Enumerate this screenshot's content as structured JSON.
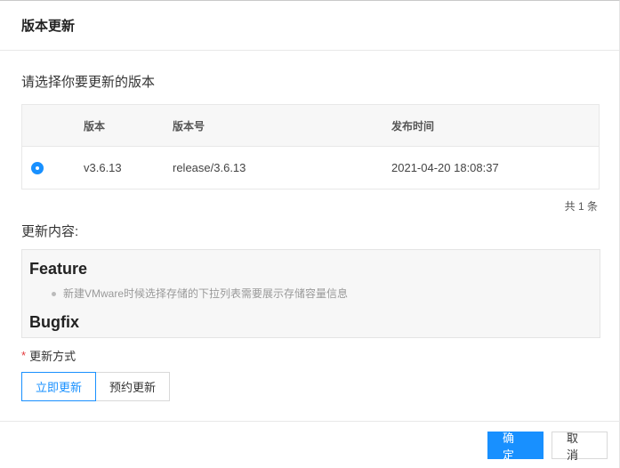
{
  "dialog": {
    "title": "版本更新"
  },
  "select_prompt": "请选择你要更新的版本",
  "table": {
    "headers": {
      "version": "版本",
      "number": "版本号",
      "time": "发布时间"
    },
    "rows": [
      {
        "selected": true,
        "version": "v3.6.13",
        "number": "release/3.6.13",
        "time": "2021-04-20 18:08:37"
      }
    ]
  },
  "pager": {
    "total_text": "共 1 条"
  },
  "content": {
    "label": "更新内容:",
    "sections": [
      {
        "heading": "Feature",
        "items": [
          "新建VMware时候选择存储的下拉列表需要展示存储容量信息"
        ]
      },
      {
        "heading": "Bugfix"
      }
    ]
  },
  "update_mode": {
    "required_mark": "*",
    "label": "更新方式",
    "options": [
      "立即更新",
      "预约更新"
    ],
    "selected": "立即更新"
  },
  "footer": {
    "confirm": "确 定",
    "cancel": "取 消"
  },
  "colors": {
    "primary": "#1890ff",
    "required": "#e4393c"
  }
}
